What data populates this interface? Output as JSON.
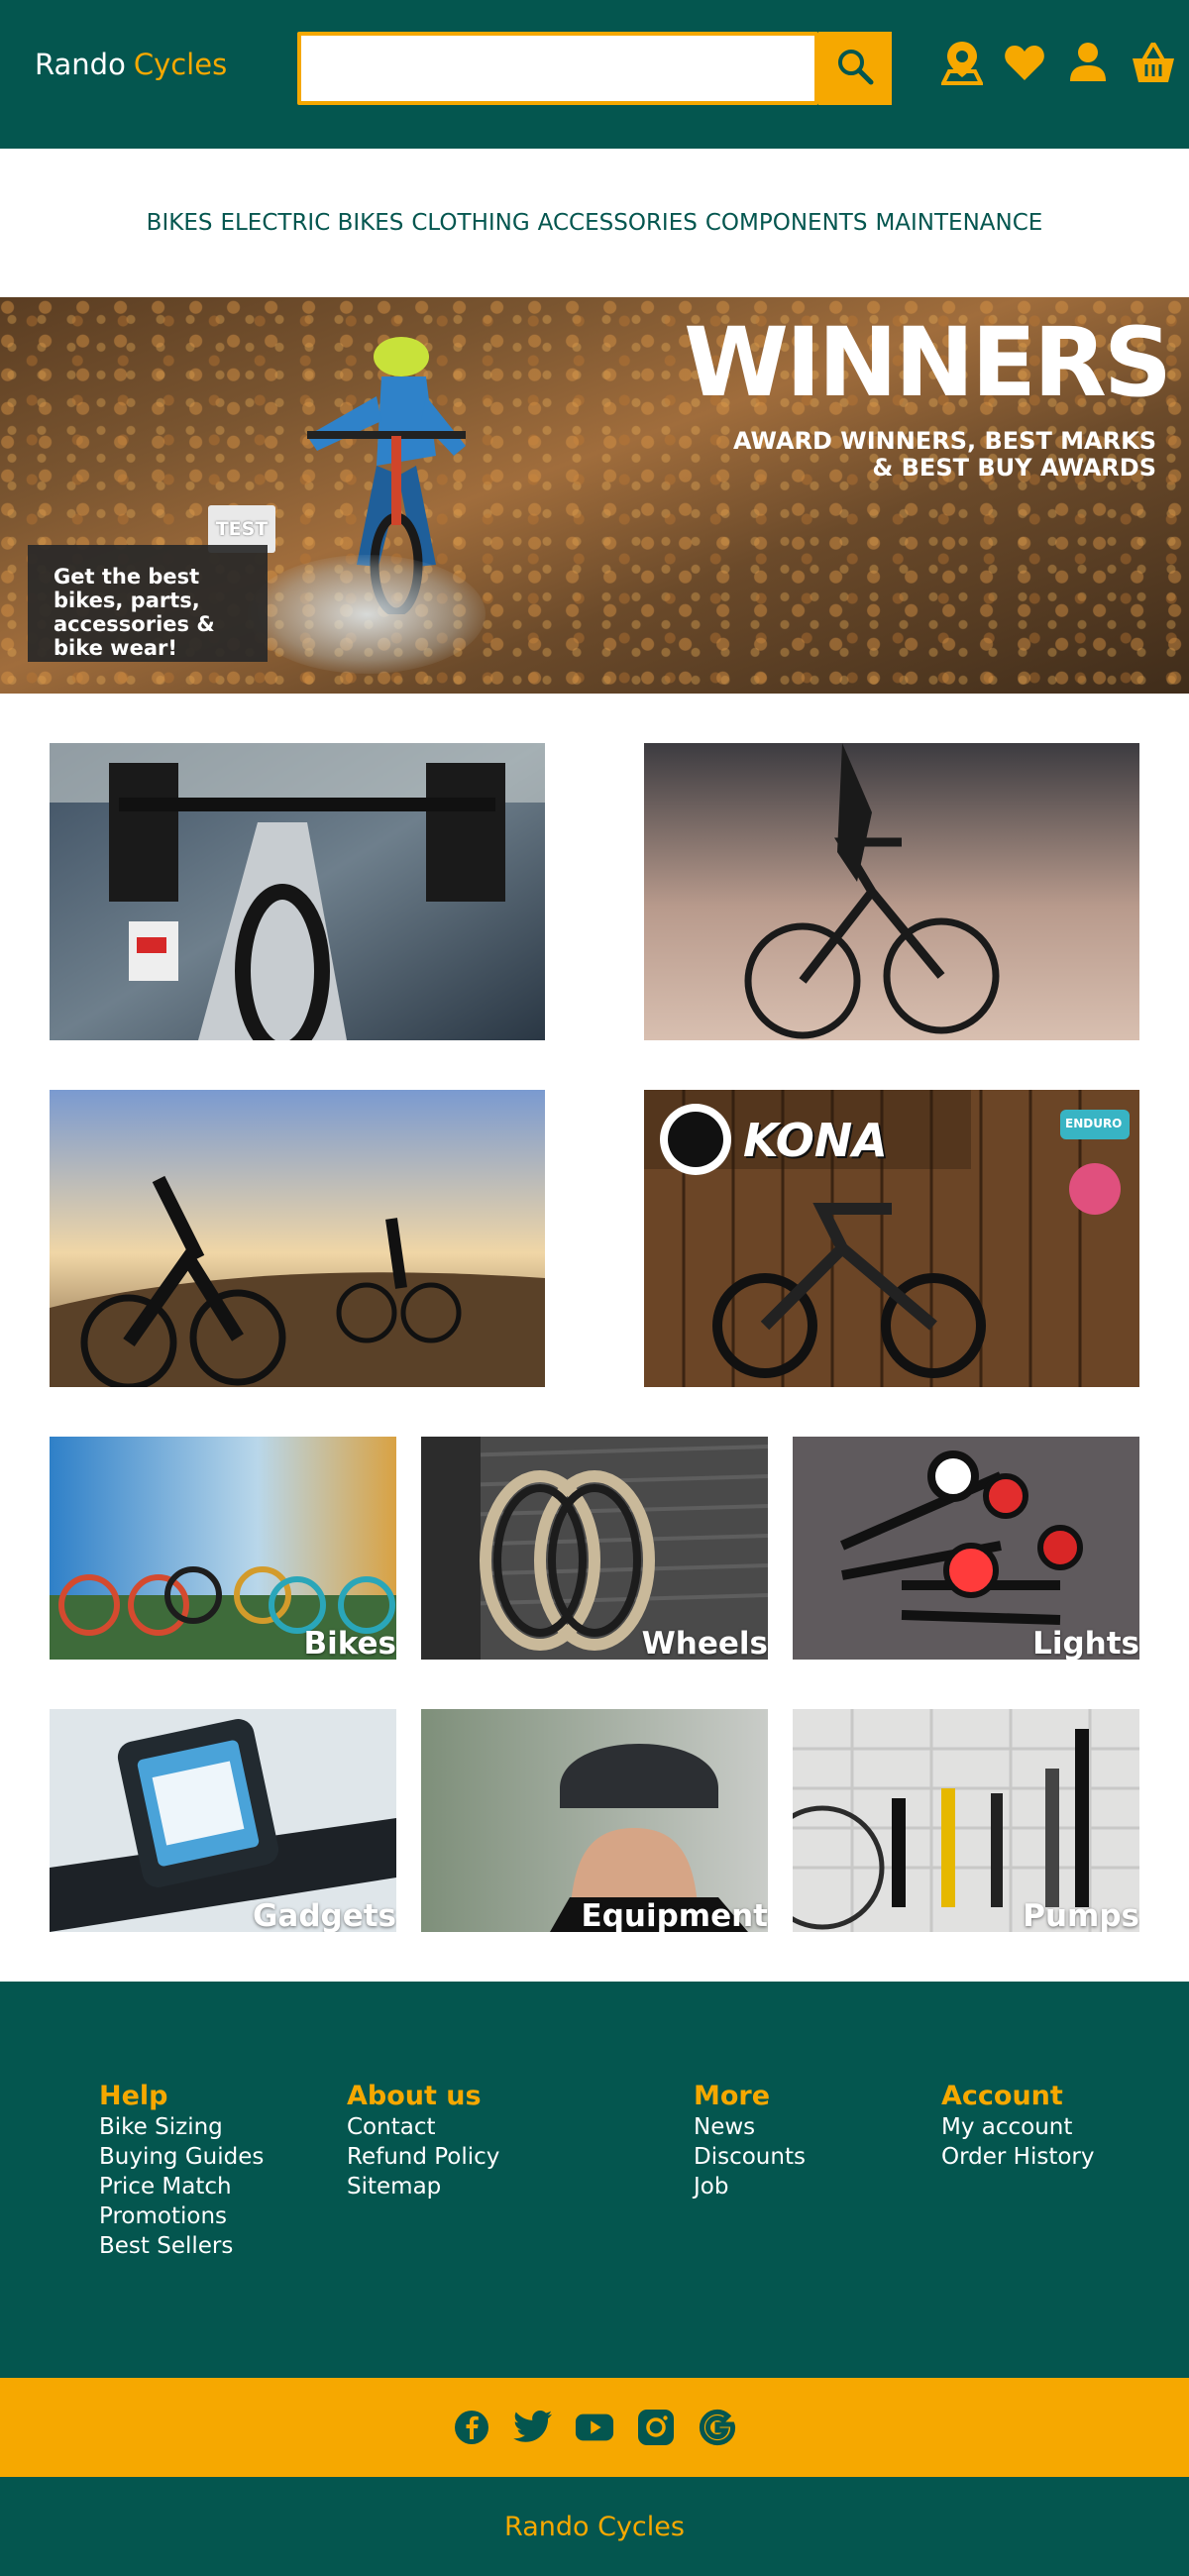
{
  "header": {
    "logo_word1": "Rando",
    "logo_word2": "Cycles",
    "search": {
      "placeholder": "",
      "button_icon": "search-icon"
    },
    "icons": [
      "store-locator-icon",
      "heart-icon",
      "user-icon",
      "basket-icon"
    ]
  },
  "nav": {
    "items": [
      "BIKES",
      "ELECTRIC BIKES",
      "CLOTHING",
      "ACCESSORIES",
      "COMPONENTS",
      "MAINTENANCE"
    ]
  },
  "hero": {
    "title": "WINNERS",
    "subtitle_line1": "AWARD WINNERS, BEST MARKS",
    "subtitle_line2": "& BEST BUY AWARDS",
    "badge_text": "Get the best bikes, parts, accessories & bike wear!",
    "test_badge": "TEST"
  },
  "promos": {
    "road_bike_alt": "road-bike-image",
    "sunset_bike_alt": "sunset-bike-image",
    "gravel_alt": "gravel-riders-image",
    "kona_brand": "KONA",
    "kona_badge": "ENDURO"
  },
  "categories": [
    {
      "label": "Bikes",
      "icon": "bikes-image"
    },
    {
      "label": "Wheels",
      "icon": "wheels-image"
    },
    {
      "label": "Lights",
      "icon": "lights-image"
    },
    {
      "label": "Gadgets",
      "icon": "gadgets-image"
    },
    {
      "label": "Equipment",
      "icon": "equipment-image"
    },
    {
      "label": "Pumps",
      "icon": "pumps-image"
    }
  ],
  "footer": {
    "help": {
      "heading": "Help",
      "links": [
        "Bike Sizing",
        "Buying Guides",
        "Price Match",
        "Promotions",
        "Best Sellers"
      ]
    },
    "about": {
      "heading": "About us",
      "links": [
        "Contact",
        "Refund Policy",
        "Sitemap"
      ]
    },
    "more": {
      "heading": "More",
      "links": [
        "News",
        "Discounts",
        "Job"
      ]
    },
    "account": {
      "heading": "Account",
      "links": [
        "My account",
        "Order History"
      ]
    }
  },
  "social": [
    "facebook-icon",
    "twitter-icon",
    "youtube-icon",
    "instagram-icon",
    "google-icon"
  ],
  "bottom": {
    "brand": "Rando Cycles"
  },
  "colors": {
    "primary": "#04564f",
    "accent": "#f6a800"
  }
}
